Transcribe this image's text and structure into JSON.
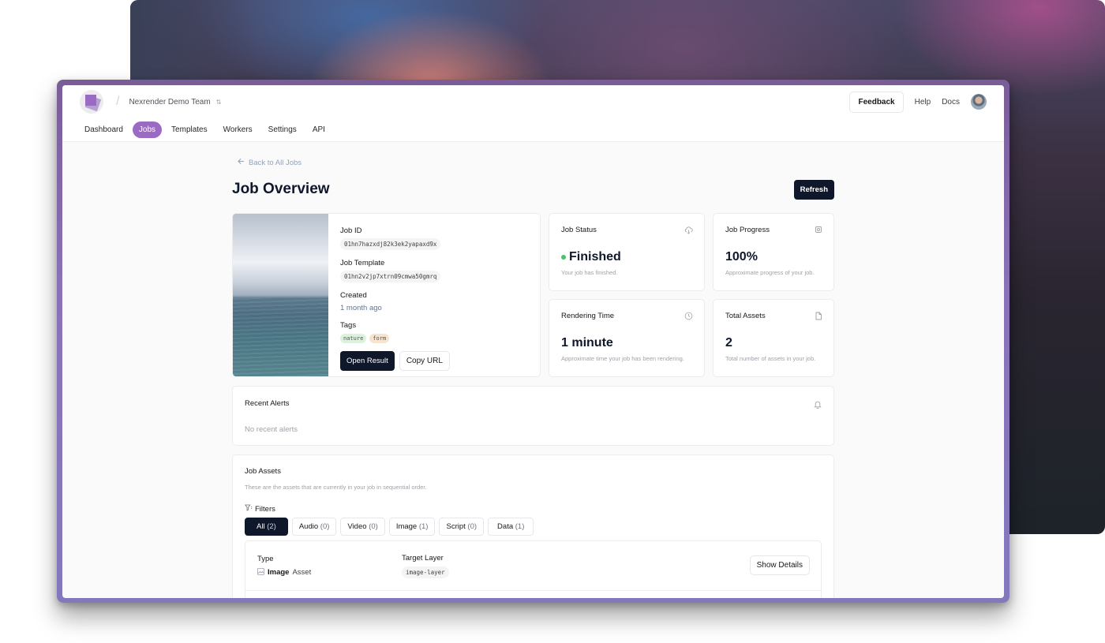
{
  "header": {
    "team_name": "Nexrender Demo Team",
    "feedback_label": "Feedback",
    "help_label": "Help",
    "docs_label": "Docs"
  },
  "nav": {
    "items": [
      {
        "label": "Dashboard",
        "active": false
      },
      {
        "label": "Jobs",
        "active": true
      },
      {
        "label": "Templates",
        "active": false
      },
      {
        "label": "Workers",
        "active": false
      },
      {
        "label": "Settings",
        "active": false
      },
      {
        "label": "API",
        "active": false
      }
    ]
  },
  "page": {
    "back_label": "Back to All Jobs",
    "title": "Job Overview",
    "refresh_label": "Refresh"
  },
  "job": {
    "id_label": "Job ID",
    "id_value": "01hn7hazxdj82k3ek2yapaxd9x",
    "template_label": "Job Template",
    "template_value": "01hn2v2jp7xtrn09cmwa50gmrq",
    "created_label": "Created",
    "created_value": "1 month ago",
    "tags_label": "Tags",
    "tags": [
      "nature",
      "form"
    ],
    "open_result_label": "Open Result",
    "copy_url_label": "Copy URL"
  },
  "stats": {
    "status": {
      "title": "Job Status",
      "value": "Finished",
      "sub": "Your job has finished.",
      "status_color": "#4ac26b"
    },
    "progress": {
      "title": "Job Progress",
      "value": "100%",
      "sub": "Approximate progress of your job."
    },
    "rendering": {
      "title": "Rendering Time",
      "value": "1 minute",
      "sub": "Approximate time your job has been rendering."
    },
    "assets": {
      "title": "Total Assets",
      "value": "2",
      "sub": "Total number of assets in your job."
    }
  },
  "alerts": {
    "title": "Recent Alerts",
    "empty": "No recent alerts"
  },
  "assets": {
    "title": "Job Assets",
    "subtitle": "These are the assets that are currently in your job in sequential order.",
    "filters_label": "Filters",
    "filters": [
      {
        "label": "All",
        "count": "(2)",
        "active": true
      },
      {
        "label": "Audio",
        "count": "(0)",
        "active": false
      },
      {
        "label": "Video",
        "count": "(0)",
        "active": false
      },
      {
        "label": "Image",
        "count": "(1)",
        "active": false
      },
      {
        "label": "Script",
        "count": "(0)",
        "active": false
      },
      {
        "label": "Data",
        "count": "(1)",
        "active": false
      }
    ],
    "rows": [
      {
        "type_label": "Type",
        "type_bold": "Image",
        "type_rest": "Asset",
        "layer_label": "Target Layer",
        "layer_value": "image-layer",
        "button": "Show Details"
      }
    ]
  },
  "colors": {
    "accent": "#9b6bc4",
    "dark_button": "#0f172a"
  }
}
